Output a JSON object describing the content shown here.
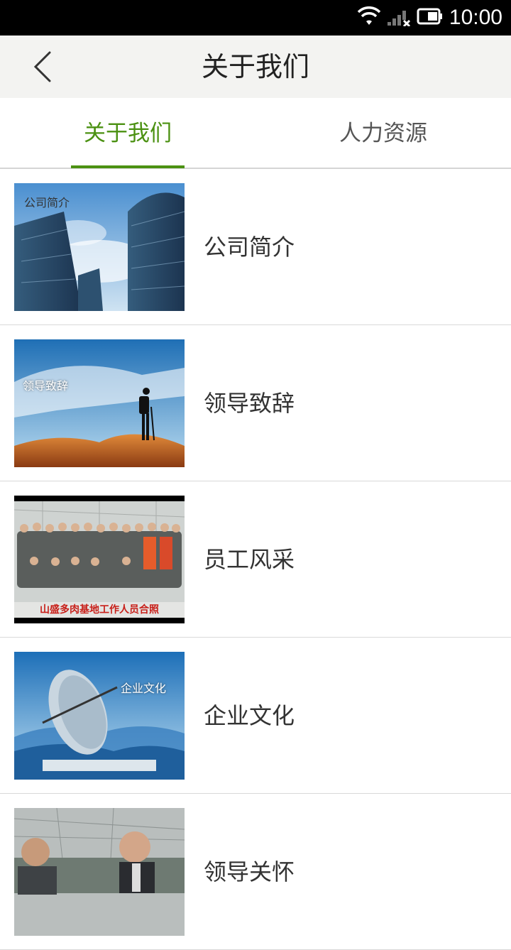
{
  "status_bar": {
    "time": "10:00"
  },
  "header": {
    "title": "关于我们"
  },
  "tabs": [
    {
      "label": "关于我们",
      "active": true
    },
    {
      "label": "人力资源",
      "active": false
    }
  ],
  "colors": {
    "accent": "#4b9112",
    "header_bg": "#f3f3f1"
  },
  "list": [
    {
      "label": "公司简介",
      "image_caption": "公司简介"
    },
    {
      "label": "领导致辞",
      "image_caption": "领导致辞"
    },
    {
      "label": "员工风采",
      "image_caption": "山盛多肉基地工作人员合照"
    },
    {
      "label": "企业文化",
      "image_caption": "企业文化"
    },
    {
      "label": "领导关怀",
      "image_caption": ""
    }
  ]
}
